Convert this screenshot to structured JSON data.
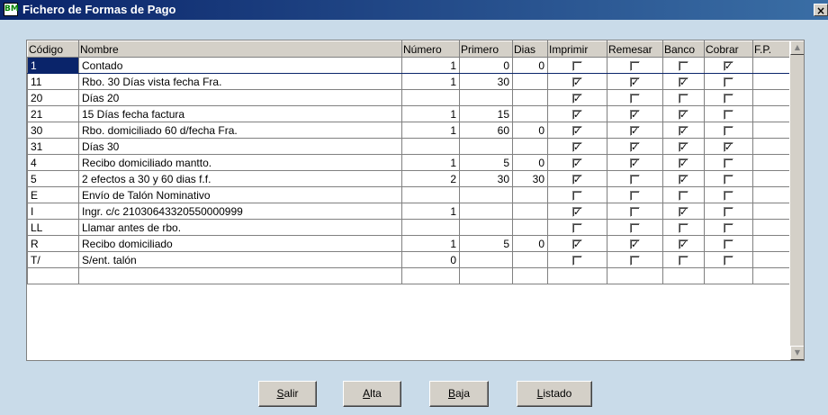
{
  "window": {
    "title": "Fichero de Formas de Pago",
    "close": "×",
    "app_icon": "BM"
  },
  "columns": [
    "Código",
    "Nombre",
    "Número",
    "Primero",
    "Dias",
    "Imprimir",
    "Remesar",
    "Banco",
    "Cobrar",
    "F.P."
  ],
  "rows": [
    {
      "codigo": "1",
      "nombre": "Contado",
      "numero": "1",
      "primero": "0",
      "dias": "0",
      "imprimir": false,
      "remesar": false,
      "banco": false,
      "cobrar": true,
      "fp": ""
    },
    {
      "codigo": "11",
      "nombre": "Rbo. 30 Días vista fecha Fra.",
      "numero": "1",
      "primero": "30",
      "dias": "",
      "imprimir": true,
      "remesar": true,
      "banco": true,
      "cobrar": false,
      "fp": ""
    },
    {
      "codigo": "20",
      "nombre": "Días 20",
      "numero": "",
      "primero": "",
      "dias": "",
      "imprimir": true,
      "remesar": false,
      "banco": false,
      "cobrar": false,
      "fp": ""
    },
    {
      "codigo": "21",
      "nombre": "15 Días fecha factura",
      "numero": "1",
      "primero": "15",
      "dias": "",
      "imprimir": true,
      "remesar": true,
      "banco": true,
      "cobrar": false,
      "fp": ""
    },
    {
      "codigo": "30",
      "nombre": "Rbo. domiciliado 60 d/fecha Fra.",
      "numero": "1",
      "primero": "60",
      "dias": "0",
      "imprimir": true,
      "remesar": true,
      "banco": true,
      "cobrar": false,
      "fp": ""
    },
    {
      "codigo": "31",
      "nombre": "Días 30",
      "numero": "",
      "primero": "",
      "dias": "",
      "imprimir": true,
      "remesar": true,
      "banco": true,
      "cobrar": true,
      "fp": ""
    },
    {
      "codigo": "4",
      "nombre": "Recibo domiciliado mantto.",
      "numero": "1",
      "primero": "5",
      "dias": "0",
      "imprimir": true,
      "remesar": true,
      "banco": true,
      "cobrar": false,
      "fp": ""
    },
    {
      "codigo": "5",
      "nombre": "2 efectos a 30 y 60 dias f.f.",
      "numero": "2",
      "primero": "30",
      "dias": "30",
      "imprimir": true,
      "remesar": false,
      "banco": true,
      "cobrar": false,
      "fp": ""
    },
    {
      "codigo": "E",
      "nombre": "Envío de Talón Nominativo",
      "numero": "",
      "primero": "",
      "dias": "",
      "imprimir": false,
      "remesar": false,
      "banco": false,
      "cobrar": false,
      "fp": ""
    },
    {
      "codigo": "I",
      "nombre": "Ingr. c/c 21030643320550000999",
      "numero": "1",
      "primero": "",
      "dias": "",
      "imprimir": true,
      "remesar": false,
      "banco": true,
      "cobrar": false,
      "fp": ""
    },
    {
      "codigo": "LL",
      "nombre": "Llamar antes de rbo.",
      "numero": "",
      "primero": "",
      "dias": "",
      "imprimir": false,
      "remesar": false,
      "banco": false,
      "cobrar": false,
      "fp": ""
    },
    {
      "codigo": "R",
      "nombre": "Recibo domiciliado",
      "numero": "1",
      "primero": "5",
      "dias": "0",
      "imprimir": true,
      "remesar": true,
      "banco": true,
      "cobrar": false,
      "fp": ""
    },
    {
      "codigo": "T/",
      "nombre": "S/ent. talón",
      "numero": "0",
      "primero": "",
      "dias": "",
      "imprimir": false,
      "remesar": false,
      "banco": false,
      "cobrar": false,
      "fp": ""
    }
  ],
  "empty_rows": 1,
  "checkmark": "✓",
  "buttons": [
    {
      "name": "salir-button",
      "label": "Salir",
      "accel": "S",
      "rest": "alir"
    },
    {
      "name": "alta-button",
      "label": "Alta",
      "accel": "A",
      "rest": "lta"
    },
    {
      "name": "baja-button",
      "label": "Baja",
      "accel": "B",
      "rest": "aja"
    },
    {
      "name": "listado-button",
      "label": "Listado",
      "accel": "L",
      "rest": "istado"
    }
  ],
  "scroll_up": "▲",
  "scroll_down": "▼"
}
